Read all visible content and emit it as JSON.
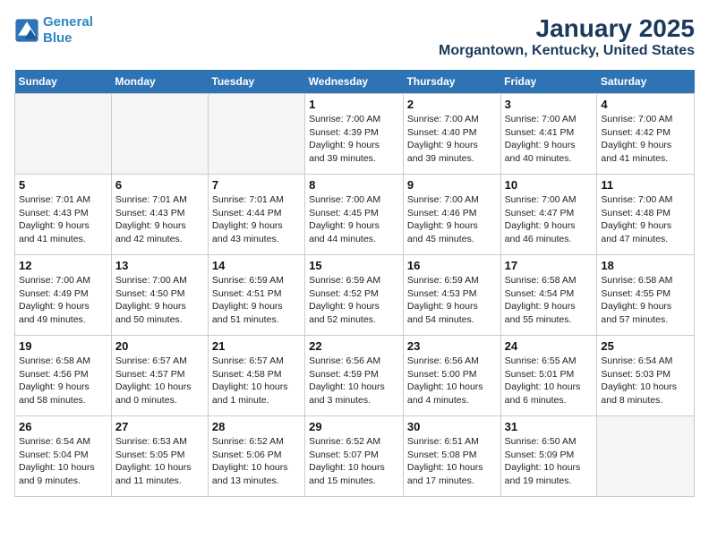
{
  "logo": {
    "line1": "General",
    "line2": "Blue"
  },
  "title": "January 2025",
  "subtitle": "Morgantown, Kentucky, United States",
  "days_of_week": [
    "Sunday",
    "Monday",
    "Tuesday",
    "Wednesday",
    "Thursday",
    "Friday",
    "Saturday"
  ],
  "weeks": [
    [
      {
        "day": "",
        "info": ""
      },
      {
        "day": "",
        "info": ""
      },
      {
        "day": "",
        "info": ""
      },
      {
        "day": "1",
        "info": "Sunrise: 7:00 AM\nSunset: 4:39 PM\nDaylight: 9 hours\nand 39 minutes."
      },
      {
        "day": "2",
        "info": "Sunrise: 7:00 AM\nSunset: 4:40 PM\nDaylight: 9 hours\nand 39 minutes."
      },
      {
        "day": "3",
        "info": "Sunrise: 7:00 AM\nSunset: 4:41 PM\nDaylight: 9 hours\nand 40 minutes."
      },
      {
        "day": "4",
        "info": "Sunrise: 7:00 AM\nSunset: 4:42 PM\nDaylight: 9 hours\nand 41 minutes."
      }
    ],
    [
      {
        "day": "5",
        "info": "Sunrise: 7:01 AM\nSunset: 4:43 PM\nDaylight: 9 hours\nand 41 minutes."
      },
      {
        "day": "6",
        "info": "Sunrise: 7:01 AM\nSunset: 4:43 PM\nDaylight: 9 hours\nand 42 minutes."
      },
      {
        "day": "7",
        "info": "Sunrise: 7:01 AM\nSunset: 4:44 PM\nDaylight: 9 hours\nand 43 minutes."
      },
      {
        "day": "8",
        "info": "Sunrise: 7:00 AM\nSunset: 4:45 PM\nDaylight: 9 hours\nand 44 minutes."
      },
      {
        "day": "9",
        "info": "Sunrise: 7:00 AM\nSunset: 4:46 PM\nDaylight: 9 hours\nand 45 minutes."
      },
      {
        "day": "10",
        "info": "Sunrise: 7:00 AM\nSunset: 4:47 PM\nDaylight: 9 hours\nand 46 minutes."
      },
      {
        "day": "11",
        "info": "Sunrise: 7:00 AM\nSunset: 4:48 PM\nDaylight: 9 hours\nand 47 minutes."
      }
    ],
    [
      {
        "day": "12",
        "info": "Sunrise: 7:00 AM\nSunset: 4:49 PM\nDaylight: 9 hours\nand 49 minutes."
      },
      {
        "day": "13",
        "info": "Sunrise: 7:00 AM\nSunset: 4:50 PM\nDaylight: 9 hours\nand 50 minutes."
      },
      {
        "day": "14",
        "info": "Sunrise: 6:59 AM\nSunset: 4:51 PM\nDaylight: 9 hours\nand 51 minutes."
      },
      {
        "day": "15",
        "info": "Sunrise: 6:59 AM\nSunset: 4:52 PM\nDaylight: 9 hours\nand 52 minutes."
      },
      {
        "day": "16",
        "info": "Sunrise: 6:59 AM\nSunset: 4:53 PM\nDaylight: 9 hours\nand 54 minutes."
      },
      {
        "day": "17",
        "info": "Sunrise: 6:58 AM\nSunset: 4:54 PM\nDaylight: 9 hours\nand 55 minutes."
      },
      {
        "day": "18",
        "info": "Sunrise: 6:58 AM\nSunset: 4:55 PM\nDaylight: 9 hours\nand 57 minutes."
      }
    ],
    [
      {
        "day": "19",
        "info": "Sunrise: 6:58 AM\nSunset: 4:56 PM\nDaylight: 9 hours\nand 58 minutes."
      },
      {
        "day": "20",
        "info": "Sunrise: 6:57 AM\nSunset: 4:57 PM\nDaylight: 10 hours\nand 0 minutes."
      },
      {
        "day": "21",
        "info": "Sunrise: 6:57 AM\nSunset: 4:58 PM\nDaylight: 10 hours\nand 1 minute."
      },
      {
        "day": "22",
        "info": "Sunrise: 6:56 AM\nSunset: 4:59 PM\nDaylight: 10 hours\nand 3 minutes."
      },
      {
        "day": "23",
        "info": "Sunrise: 6:56 AM\nSunset: 5:00 PM\nDaylight: 10 hours\nand 4 minutes."
      },
      {
        "day": "24",
        "info": "Sunrise: 6:55 AM\nSunset: 5:01 PM\nDaylight: 10 hours\nand 6 minutes."
      },
      {
        "day": "25",
        "info": "Sunrise: 6:54 AM\nSunset: 5:03 PM\nDaylight: 10 hours\nand 8 minutes."
      }
    ],
    [
      {
        "day": "26",
        "info": "Sunrise: 6:54 AM\nSunset: 5:04 PM\nDaylight: 10 hours\nand 9 minutes."
      },
      {
        "day": "27",
        "info": "Sunrise: 6:53 AM\nSunset: 5:05 PM\nDaylight: 10 hours\nand 11 minutes."
      },
      {
        "day": "28",
        "info": "Sunrise: 6:52 AM\nSunset: 5:06 PM\nDaylight: 10 hours\nand 13 minutes."
      },
      {
        "day": "29",
        "info": "Sunrise: 6:52 AM\nSunset: 5:07 PM\nDaylight: 10 hours\nand 15 minutes."
      },
      {
        "day": "30",
        "info": "Sunrise: 6:51 AM\nSunset: 5:08 PM\nDaylight: 10 hours\nand 17 minutes."
      },
      {
        "day": "31",
        "info": "Sunrise: 6:50 AM\nSunset: 5:09 PM\nDaylight: 10 hours\nand 19 minutes."
      },
      {
        "day": "",
        "info": ""
      }
    ]
  ]
}
